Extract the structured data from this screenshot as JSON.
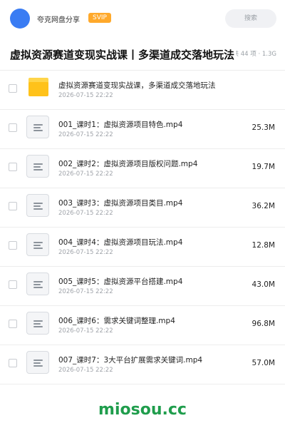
{
  "header": {
    "brand": "夸克网盘分享",
    "badge": "SVIP",
    "search_placeholder": "搜索",
    "avatar_color": "#3a7cf3"
  },
  "folder": {
    "title": "虚拟资源赛道变现实战课丨多渠道成交落地玩法",
    "meta": "共 44 项 · 1.3G"
  },
  "items": [
    {
      "type": "folder",
      "name": "虚拟资源赛道变现实战课，多渠道成交落地玩法",
      "date": "2026-07-15 22:22",
      "size": ""
    },
    {
      "type": "file",
      "name": "001_课时1：虚拟资源项目特色.mp4",
      "date": "2026-07-15 22:22",
      "size": "25.3M"
    },
    {
      "type": "file",
      "name": "002_课时2：虚拟资源项目版权问题.mp4",
      "date": "2026-07-15 22:22",
      "size": "19.7M"
    },
    {
      "type": "file",
      "name": "003_课时3：虚拟资源项目类目.mp4",
      "date": "2026-07-15 22:22",
      "size": "36.2M"
    },
    {
      "type": "file",
      "name": "004_课时4：虚拟资源项目玩法.mp4",
      "date": "2026-07-15 22:22",
      "size": "12.8M"
    },
    {
      "type": "file",
      "name": "005_课时5：虚拟资源平台搭建.mp4",
      "date": "2026-07-15 22:22",
      "size": "43.0M"
    },
    {
      "type": "file",
      "name": "006_课时6：需求关键词整理.mp4",
      "date": "2026-07-15 22:22",
      "size": "96.8M"
    },
    {
      "type": "file",
      "name": "007_课时7：3大平台扩展需求关键词.mp4",
      "date": "2026-07-15 22:22",
      "size": "57.0M"
    }
  ],
  "watermark": "miosou.cc",
  "colors": {
    "badge": "#ffa92b",
    "folder_icon": "#ffc21a",
    "watermark": "#1f9d4c"
  }
}
